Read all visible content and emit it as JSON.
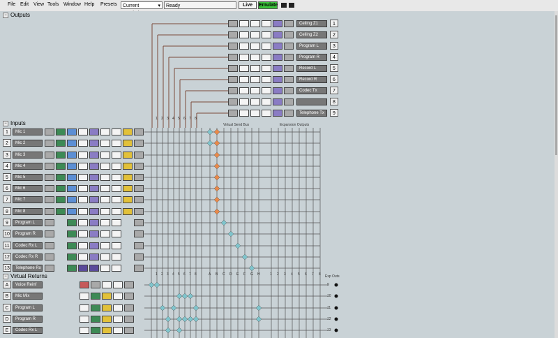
{
  "menu": [
    "File",
    "Edit",
    "View",
    "Tools",
    "Window",
    "Help"
  ],
  "toolbar": {
    "presets_label": "Presets",
    "preset_value": "Current Emulation",
    "status": "Ready",
    "live_label": "Live",
    "emulate_label": "Emulate"
  },
  "outputs": {
    "title": "Outputs",
    "channels": [
      "Ceiling Z1",
      "Ceiling Z2",
      "Program L",
      "Program R",
      "Record L",
      "Record R",
      "Codec Tx",
      "",
      "Telephone Tx"
    ],
    "numbers": [
      "1",
      "2",
      "3",
      "4",
      "5",
      "6",
      "7",
      "8",
      "9"
    ]
  },
  "inputs": {
    "title": "Inputs",
    "channels": [
      "Mic 1",
      "Mic 2",
      "Mic 3",
      "Mic 4",
      "Mic 5",
      "Mic 6",
      "Mic 7",
      "Mic 8",
      "Program L",
      "Program R",
      "Codec Rx L",
      "Codec Rx R",
      "Telephone Rx"
    ],
    "numbers": [
      "1",
      "2",
      "3",
      "4",
      "5",
      "6",
      "7",
      "8",
      "9",
      "10",
      "11",
      "12",
      "13"
    ]
  },
  "virtual_returns": {
    "title": "Virtual Returns",
    "channels": [
      "Voice Reinf",
      "Mic Mix",
      "Program L",
      "Program R",
      "Codec Rx L"
    ],
    "letters": [
      "A",
      "B",
      "C",
      "D",
      "E"
    ]
  },
  "bus_labels": {
    "virtual_send_bus": "Virtual Send Bus",
    "expansion_outputs": "Expansion Outputs",
    "exp_outs": "Exp Outs",
    "exp_out_numbers": [
      "9",
      "10",
      "11",
      "12",
      "13"
    ]
  },
  "bus_columns_top": [
    "1",
    "2",
    "3",
    "4",
    "5",
    "6",
    "7",
    "8"
  ],
  "bus_columns_mid": [
    "A",
    "B",
    "C",
    "D",
    "E",
    "F",
    "G",
    "H"
  ],
  "bus_columns_exp": [
    "1",
    "2",
    "3",
    "4",
    "5",
    "6",
    "7",
    "8"
  ],
  "colors": {
    "accent_orange": "#e8894a",
    "node_teal": "#7fc4cc",
    "emulate_green": "#3cc43c"
  }
}
